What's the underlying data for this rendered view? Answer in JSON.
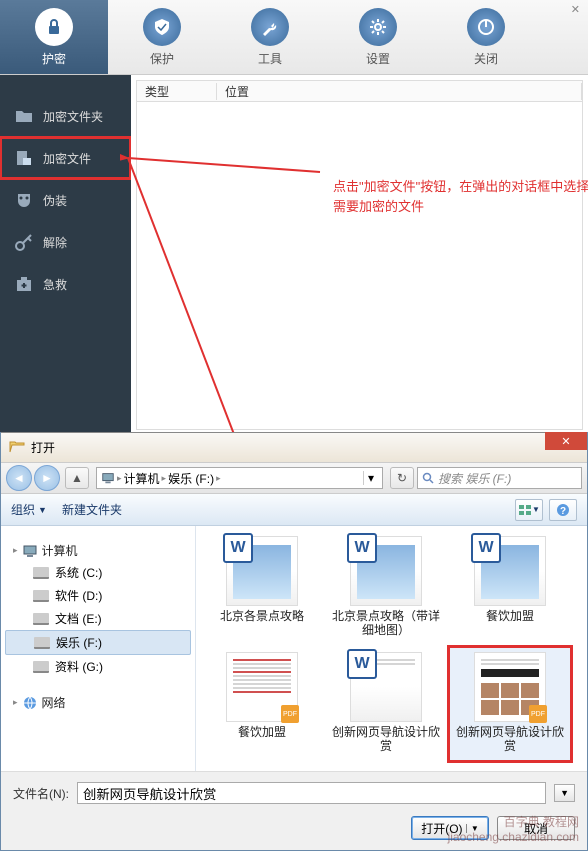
{
  "toolbar": [
    {
      "label": "护密",
      "icon": "lock-icon",
      "active": true
    },
    {
      "label": "保护",
      "icon": "shield-icon"
    },
    {
      "label": "工具",
      "icon": "wrench-icon"
    },
    {
      "label": "设置",
      "icon": "gear-icon"
    },
    {
      "label": "关闭",
      "icon": "power-icon"
    }
  ],
  "sidebar": [
    {
      "label": "加密文件夹",
      "icon": "folder-icon"
    },
    {
      "label": "加密文件",
      "icon": "file-lock-icon",
      "highlighted": true
    },
    {
      "label": "伪装",
      "icon": "theater-icon"
    },
    {
      "label": "解除",
      "icon": "key-icon"
    },
    {
      "label": "急救",
      "icon": "firstaid-icon"
    }
  ],
  "columns": {
    "type": "类型",
    "location": "位置"
  },
  "annotation": "点击\"加密文件\"按钮，在弹出的对话框中选择需要加密的文件",
  "dialog": {
    "title": "打开",
    "breadcrumb": [
      "计算机",
      "娱乐 (F:)"
    ],
    "search_placeholder": "搜索 娱乐 (F:)",
    "toolbar": {
      "organize": "组织",
      "newfolder": "新建文件夹"
    },
    "tree": {
      "root": "计算机",
      "drives": [
        {
          "label": "系统 (C:)"
        },
        {
          "label": "软件 (D:)"
        },
        {
          "label": "文档 (E:)"
        },
        {
          "label": "娱乐 (F:)",
          "selected": true
        },
        {
          "label": "资料 (G:)"
        }
      ],
      "network": "网络"
    },
    "files": [
      {
        "name": "北京各景点攻略",
        "type": "word"
      },
      {
        "name": "北京景点攻略（带详细地图）",
        "type": "word"
      },
      {
        "name": "餐饮加盟",
        "type": "word"
      },
      {
        "name": "餐饮加盟",
        "type": "pdf-text"
      },
      {
        "name": "创新网页导航设计欣赏",
        "type": "word"
      },
      {
        "name": "创新网页导航设计欣赏",
        "type": "pdf-web",
        "selected": true
      }
    ],
    "filename_label": "文件名(N):",
    "filename_value": "创新网页导航设计欣赏",
    "open_btn": "打开(O)",
    "cancel_btn": "取消"
  },
  "watermark": "百字典 教程网\njiaocheng.chazidian.com"
}
